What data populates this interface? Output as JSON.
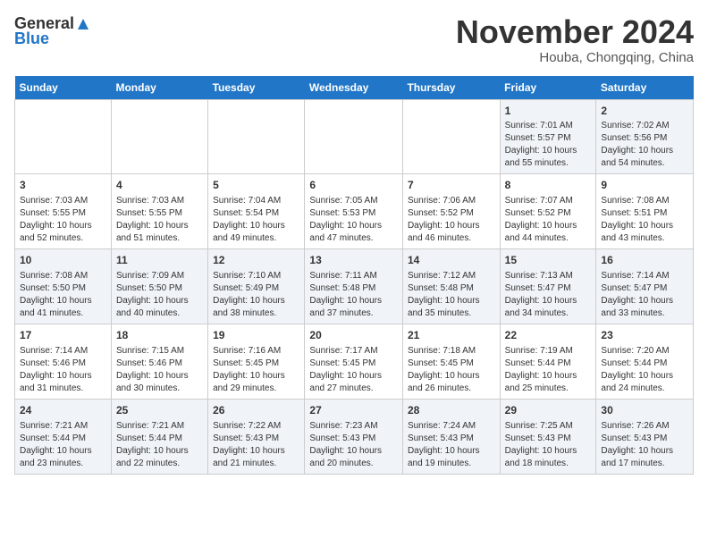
{
  "logo": {
    "line1": "General",
    "line2": "Blue"
  },
  "title": "November 2024",
  "subtitle": "Houba, Chongqing, China",
  "weekdays": [
    "Sunday",
    "Monday",
    "Tuesday",
    "Wednesday",
    "Thursday",
    "Friday",
    "Saturday"
  ],
  "weeks": [
    [
      {
        "day": "",
        "info": ""
      },
      {
        "day": "",
        "info": ""
      },
      {
        "day": "",
        "info": ""
      },
      {
        "day": "",
        "info": ""
      },
      {
        "day": "",
        "info": ""
      },
      {
        "day": "1",
        "info": "Sunrise: 7:01 AM\nSunset: 5:57 PM\nDaylight: 10 hours\nand 55 minutes."
      },
      {
        "day": "2",
        "info": "Sunrise: 7:02 AM\nSunset: 5:56 PM\nDaylight: 10 hours\nand 54 minutes."
      }
    ],
    [
      {
        "day": "3",
        "info": "Sunrise: 7:03 AM\nSunset: 5:55 PM\nDaylight: 10 hours\nand 52 minutes."
      },
      {
        "day": "4",
        "info": "Sunrise: 7:03 AM\nSunset: 5:55 PM\nDaylight: 10 hours\nand 51 minutes."
      },
      {
        "day": "5",
        "info": "Sunrise: 7:04 AM\nSunset: 5:54 PM\nDaylight: 10 hours\nand 49 minutes."
      },
      {
        "day": "6",
        "info": "Sunrise: 7:05 AM\nSunset: 5:53 PM\nDaylight: 10 hours\nand 47 minutes."
      },
      {
        "day": "7",
        "info": "Sunrise: 7:06 AM\nSunset: 5:52 PM\nDaylight: 10 hours\nand 46 minutes."
      },
      {
        "day": "8",
        "info": "Sunrise: 7:07 AM\nSunset: 5:52 PM\nDaylight: 10 hours\nand 44 minutes."
      },
      {
        "day": "9",
        "info": "Sunrise: 7:08 AM\nSunset: 5:51 PM\nDaylight: 10 hours\nand 43 minutes."
      }
    ],
    [
      {
        "day": "10",
        "info": "Sunrise: 7:08 AM\nSunset: 5:50 PM\nDaylight: 10 hours\nand 41 minutes."
      },
      {
        "day": "11",
        "info": "Sunrise: 7:09 AM\nSunset: 5:50 PM\nDaylight: 10 hours\nand 40 minutes."
      },
      {
        "day": "12",
        "info": "Sunrise: 7:10 AM\nSunset: 5:49 PM\nDaylight: 10 hours\nand 38 minutes."
      },
      {
        "day": "13",
        "info": "Sunrise: 7:11 AM\nSunset: 5:48 PM\nDaylight: 10 hours\nand 37 minutes."
      },
      {
        "day": "14",
        "info": "Sunrise: 7:12 AM\nSunset: 5:48 PM\nDaylight: 10 hours\nand 35 minutes."
      },
      {
        "day": "15",
        "info": "Sunrise: 7:13 AM\nSunset: 5:47 PM\nDaylight: 10 hours\nand 34 minutes."
      },
      {
        "day": "16",
        "info": "Sunrise: 7:14 AM\nSunset: 5:47 PM\nDaylight: 10 hours\nand 33 minutes."
      }
    ],
    [
      {
        "day": "17",
        "info": "Sunrise: 7:14 AM\nSunset: 5:46 PM\nDaylight: 10 hours\nand 31 minutes."
      },
      {
        "day": "18",
        "info": "Sunrise: 7:15 AM\nSunset: 5:46 PM\nDaylight: 10 hours\nand 30 minutes."
      },
      {
        "day": "19",
        "info": "Sunrise: 7:16 AM\nSunset: 5:45 PM\nDaylight: 10 hours\nand 29 minutes."
      },
      {
        "day": "20",
        "info": "Sunrise: 7:17 AM\nSunset: 5:45 PM\nDaylight: 10 hours\nand 27 minutes."
      },
      {
        "day": "21",
        "info": "Sunrise: 7:18 AM\nSunset: 5:45 PM\nDaylight: 10 hours\nand 26 minutes."
      },
      {
        "day": "22",
        "info": "Sunrise: 7:19 AM\nSunset: 5:44 PM\nDaylight: 10 hours\nand 25 minutes."
      },
      {
        "day": "23",
        "info": "Sunrise: 7:20 AM\nSunset: 5:44 PM\nDaylight: 10 hours\nand 24 minutes."
      }
    ],
    [
      {
        "day": "24",
        "info": "Sunrise: 7:21 AM\nSunset: 5:44 PM\nDaylight: 10 hours\nand 23 minutes."
      },
      {
        "day": "25",
        "info": "Sunrise: 7:21 AM\nSunset: 5:44 PM\nDaylight: 10 hours\nand 22 minutes."
      },
      {
        "day": "26",
        "info": "Sunrise: 7:22 AM\nSunset: 5:43 PM\nDaylight: 10 hours\nand 21 minutes."
      },
      {
        "day": "27",
        "info": "Sunrise: 7:23 AM\nSunset: 5:43 PM\nDaylight: 10 hours\nand 20 minutes."
      },
      {
        "day": "28",
        "info": "Sunrise: 7:24 AM\nSunset: 5:43 PM\nDaylight: 10 hours\nand 19 minutes."
      },
      {
        "day": "29",
        "info": "Sunrise: 7:25 AM\nSunset: 5:43 PM\nDaylight: 10 hours\nand 18 minutes."
      },
      {
        "day": "30",
        "info": "Sunrise: 7:26 AM\nSunset: 5:43 PM\nDaylight: 10 hours\nand 17 minutes."
      }
    ]
  ]
}
